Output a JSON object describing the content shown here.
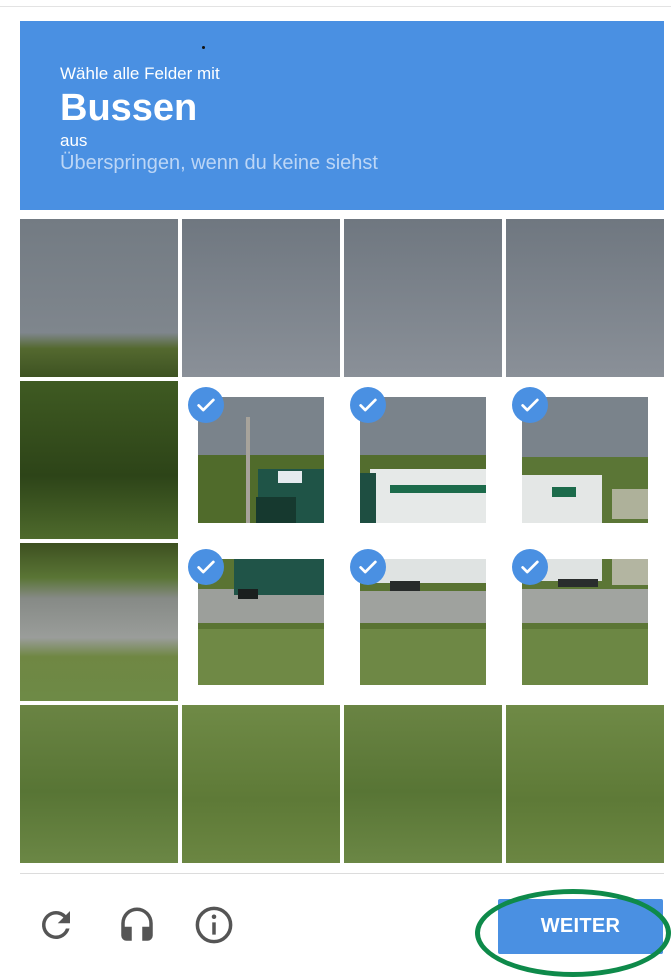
{
  "header": {
    "line1": "Wähle alle Felder mit",
    "title": "Bussen",
    "line3": "aus",
    "skip": "Überspringen, wenn du keine siehst"
  },
  "grid": {
    "rows": 4,
    "cols": 4,
    "tiles": [
      {
        "r": 0,
        "c": 0,
        "selected": false
      },
      {
        "r": 0,
        "c": 1,
        "selected": false
      },
      {
        "r": 0,
        "c": 2,
        "selected": false
      },
      {
        "r": 0,
        "c": 3,
        "selected": false
      },
      {
        "r": 1,
        "c": 0,
        "selected": false
      },
      {
        "r": 1,
        "c": 1,
        "selected": true
      },
      {
        "r": 1,
        "c": 2,
        "selected": true
      },
      {
        "r": 1,
        "c": 3,
        "selected": true
      },
      {
        "r": 2,
        "c": 0,
        "selected": false
      },
      {
        "r": 2,
        "c": 1,
        "selected": true
      },
      {
        "r": 2,
        "c": 2,
        "selected": true
      },
      {
        "r": 2,
        "c": 3,
        "selected": true
      },
      {
        "r": 3,
        "c": 0,
        "selected": false
      },
      {
        "r": 3,
        "c": 1,
        "selected": false
      },
      {
        "r": 3,
        "c": 2,
        "selected": false
      },
      {
        "r": 3,
        "c": 3,
        "selected": false
      }
    ]
  },
  "footer": {
    "icons": [
      "reload-icon",
      "audio-icon",
      "info-icon"
    ],
    "submit_label": "WEITER"
  },
  "colors": {
    "accent": "#4a90e2",
    "annotation": "#0e8a4a"
  }
}
